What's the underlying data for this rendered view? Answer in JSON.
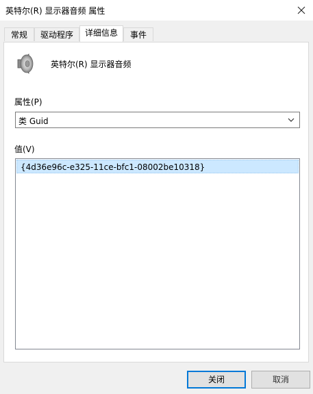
{
  "window": {
    "title": "英特尔(R) 显示器音频 属性"
  },
  "tabs": [
    {
      "label": "常规",
      "active": false
    },
    {
      "label": "驱动程序",
      "active": false
    },
    {
      "label": "详细信息",
      "active": true
    },
    {
      "label": "事件",
      "active": false
    }
  ],
  "device": {
    "name": "英特尔(R) 显示器音频",
    "icon": "speaker-icon"
  },
  "property": {
    "label": "属性(P)",
    "selected": "类 Guid"
  },
  "value": {
    "label": "值(V)",
    "items": [
      "{4d36e96c-e325-11ce-bfc1-08002be10318}"
    ]
  },
  "buttons": {
    "ok_label": "关闭",
    "cancel_label": "取消"
  },
  "colors": {
    "selection": "#cce8ff",
    "accent": "#0078d7"
  }
}
